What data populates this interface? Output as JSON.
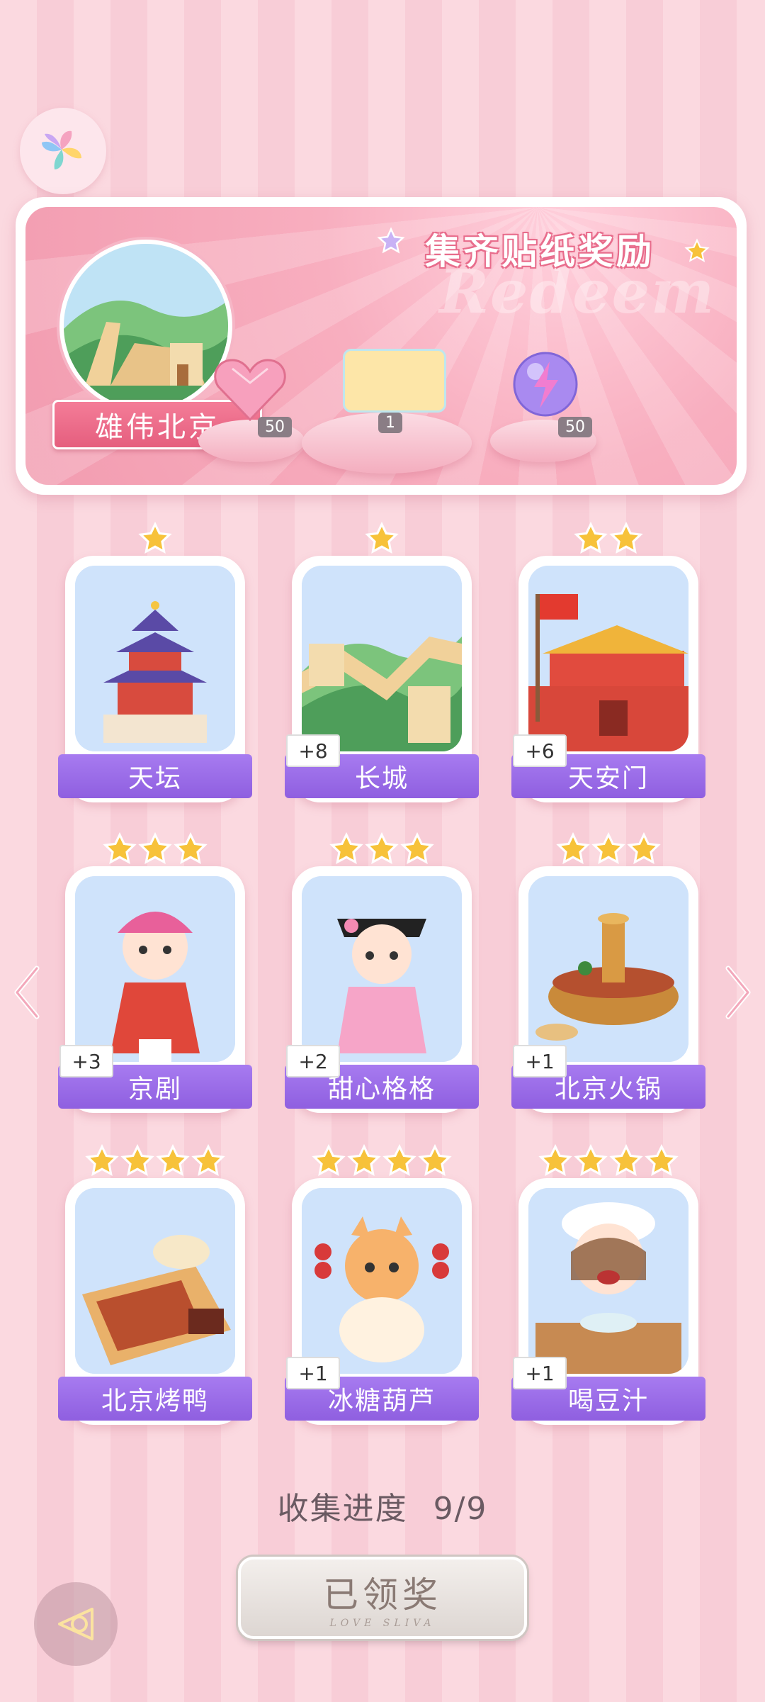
{
  "banner": {
    "title": "集齐贴纸奖励",
    "watermark": "Redeem",
    "city_name": "雄伟北京",
    "rewards": [
      {
        "icon": "pink-heart-gem-icon",
        "count": "50"
      },
      {
        "icon": "sticker-card-icon",
        "count": "1"
      },
      {
        "icon": "lightning-orb-icon",
        "count": "50"
      }
    ]
  },
  "cards": [
    {
      "label": "天坛",
      "stars": 1,
      "plus": "",
      "icon": "temple-of-heaven-icon"
    },
    {
      "label": "长城",
      "stars": 1,
      "plus": "+8",
      "icon": "great-wall-icon"
    },
    {
      "label": "天安门",
      "stars": 2,
      "plus": "+6",
      "icon": "tiananmen-icon"
    },
    {
      "label": "京剧",
      "stars": 3,
      "plus": "+3",
      "icon": "peking-opera-icon"
    },
    {
      "label": "甜心格格",
      "stars": 3,
      "plus": "+2",
      "icon": "qing-princess-icon"
    },
    {
      "label": "北京火锅",
      "stars": 3,
      "plus": "+1",
      "icon": "hotpot-icon"
    },
    {
      "label": "北京烤鸭",
      "stars": 4,
      "plus": "",
      "icon": "roast-duck-icon"
    },
    {
      "label": "冰糖葫芦",
      "stars": 4,
      "plus": "+1",
      "icon": "candied-haws-cat-icon"
    },
    {
      "label": "喝豆汁",
      "stars": 4,
      "plus": "+1",
      "icon": "douzhi-girl-icon"
    }
  ],
  "progress": {
    "label": "收集进度",
    "value": "9/9"
  },
  "claimed_button": {
    "label": "已领奖",
    "sub": "LOVE SLIVA"
  },
  "colors": {
    "accent_purple": "#9966e6",
    "banner_pink": "#f29cb0",
    "star_gold": "#f7c23a"
  }
}
